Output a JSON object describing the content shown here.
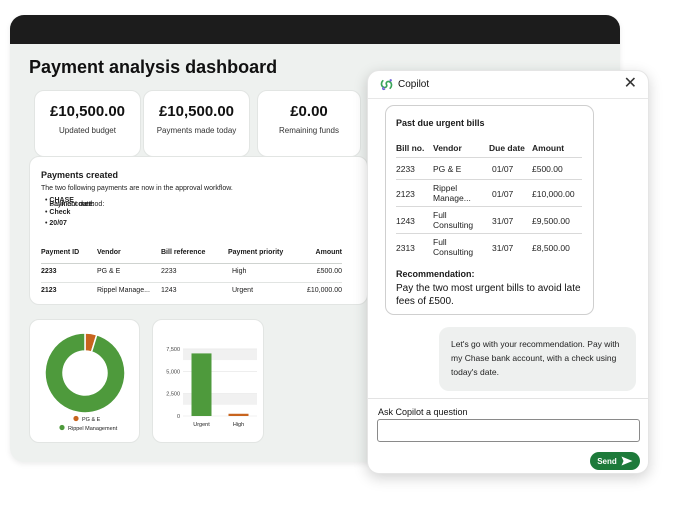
{
  "dashboard": {
    "title": "Payment analysis dashboard",
    "stats": [
      {
        "value": "£10,500.00",
        "label": "Updated budget"
      },
      {
        "value": "£10,500.00",
        "label": "Payments made today"
      },
      {
        "value": "£0.00",
        "label": "Remaining funds"
      }
    ],
    "payments": {
      "title": "Payments created",
      "intro": "The two following payments are now in the approval workflow.",
      "details": [
        {
          "label": "Bank account: ",
          "value": "CHASE"
        },
        {
          "label": "Payment method: ",
          "value": "Check"
        },
        {
          "label": "Payment date: ",
          "value": "20/07"
        }
      ],
      "headers": [
        "Payment ID",
        "Vendor",
        "Bill reference",
        "Payment priority",
        "Amount"
      ],
      "rows": [
        [
          "2233",
          "PG & E",
          "2233",
          "High",
          "£500.00"
        ],
        [
          "2123",
          "Rippel Manage...",
          "1243",
          "Urgent",
          "£10,000.00"
        ]
      ]
    }
  },
  "chart_data": [
    {
      "type": "pie",
      "categories": [
        "PG & E",
        "Rippel Management"
      ],
      "values": [
        500,
        10000
      ],
      "colors": [
        "#c8641e",
        "#4e9a3c"
      ],
      "legend_position": "bottom"
    },
    {
      "type": "bar",
      "categories": [
        "Urgent",
        "High"
      ],
      "values": [
        7000,
        250
      ],
      "colors": [
        "#4e9a3c",
        "#c8641e"
      ],
      "yticks": [
        "7,500",
        "5,000",
        "2,500",
        "0"
      ],
      "ytick_values": [
        7500,
        5000,
        2500,
        0
      ],
      "ylim": [
        0,
        8500
      ],
      "grid": true
    }
  ],
  "copilot": {
    "title": "Copilot",
    "card_title": "Past due urgent bills",
    "bill_headers": [
      "Bill no.",
      "Vendor",
      "Due date",
      "Amount"
    ],
    "bills": [
      {
        "no": "2233",
        "vendor": [
          "PG & E"
        ],
        "due": "01/07",
        "amount": "£500.00"
      },
      {
        "no": "2123",
        "vendor": [
          "Rippel",
          "Manage..."
        ],
        "due": "01/07",
        "amount": "£10,000.00"
      },
      {
        "no": "1243",
        "vendor": [
          "Full",
          "Consulting"
        ],
        "due": "31/07",
        "amount": "£9,500.00"
      },
      {
        "no": "2313",
        "vendor": [
          "Full",
          "Consulting"
        ],
        "due": "31/07",
        "amount": "£8,500.00"
      }
    ],
    "recommendation_label": "Recommendation:",
    "recommendation": "Pay the two most urgent bills to avoid late fees of £500.",
    "user_message": "Let's go with your recommendation. Pay with my Chase bank account, with a check using today's date.",
    "ask_label": "Ask Copilot a question",
    "ask_value": "",
    "send_label": "Send",
    "accent": "#1d7a3a",
    "icons": {
      "logo": "copilot-logo-icon",
      "close": "close-icon",
      "send": "send-arrow-icon"
    }
  }
}
